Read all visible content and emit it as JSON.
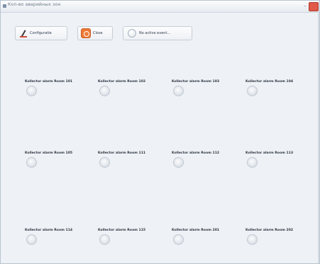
{
  "window": {
    "title": "Кол-во аварийных зон"
  },
  "toolbar": {
    "config_label": "Configuratie",
    "close_label": "Close",
    "noactive_label": "No active event..."
  },
  "alarms": [
    "Kollector alarm Room 101",
    "Kollector alarm Room 102",
    "Kollector alarm Room 103",
    "Kollector alarm Room 104",
    "Kollector alarm Room 105",
    "Kollector alarm Room 111",
    "Kollector alarm Room 112",
    "Kollector alarm Room 113",
    "Kollector alarm Room 114",
    "Kollector alarm Room 115",
    "Kollector alarm Room 201",
    "Kollector alarm Room 202"
  ],
  "colors": {
    "close_accent": "#ef7a38",
    "window_close": "#e05a47",
    "background": "#eef1f5"
  },
  "icons": [
    "pencil-icon",
    "close-icon",
    "radio-icon",
    "led-indicator"
  ]
}
